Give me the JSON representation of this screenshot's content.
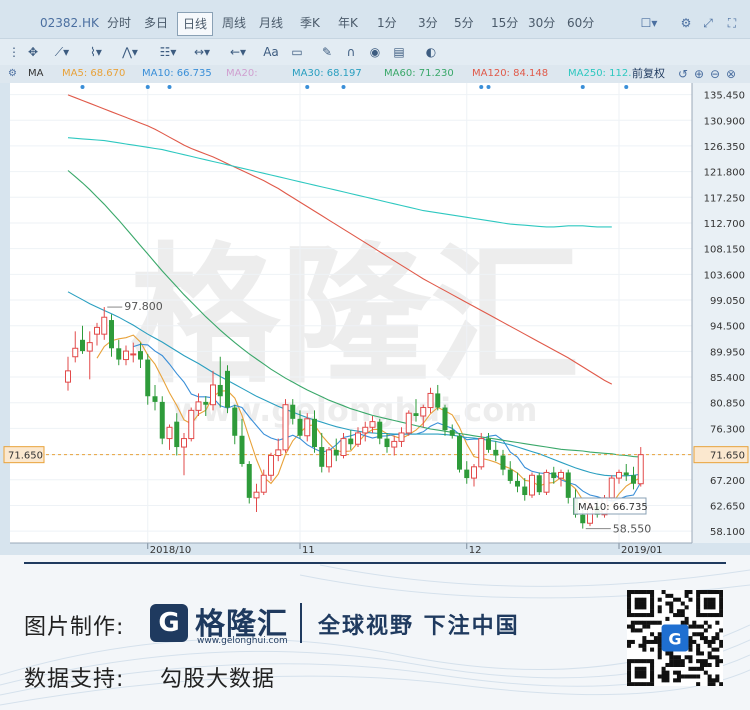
{
  "toolbar": {
    "ticker": "02382.HK",
    "periods": [
      "分时",
      "多日",
      "日线",
      "周线",
      "月线",
      "季K",
      "年K",
      "1分",
      "3分",
      "5分",
      "15分",
      "30分",
      "60分"
    ],
    "active_period": "日线"
  },
  "ma_row": {
    "label": "MA",
    "items": [
      {
        "text": "MA5: 68.670",
        "color": "#e8a23a"
      },
      {
        "text": "MA10: 66.735",
        "color": "#3a8fd8"
      },
      {
        "text": "MA20:",
        "color": "#d0a0d0"
      },
      {
        "text": "MA30: 68.197",
        "color": "#2a9fc0"
      },
      {
        "text": "MA60: 71.230",
        "color": "#3aa86a"
      },
      {
        "text": "MA120: 84.148",
        "color": "#e05a4a"
      },
      {
        "text": "MA250: 112.",
        "color": "#2ec8c0"
      }
    ],
    "adjust_label": "前复权"
  },
  "watermark": {
    "brand": "格隆汇",
    "url": "www.gelonghui.com"
  },
  "chart_data": {
    "type": "candlestick",
    "y_ticks": [
      "135.450",
      "130.900",
      "126.350",
      "121.800",
      "117.250",
      "112.700",
      "108.150",
      "103.600",
      "99.050",
      "94.500",
      "89.950",
      "85.400",
      "80.850",
      "76.300",
      "71.650",
      "67.200",
      "62.650",
      "58.100"
    ],
    "ylim": [
      56.0,
      137.5
    ],
    "x_labels": [
      {
        "label": "2018/10",
        "index": 11
      },
      {
        "label": "11",
        "index": 32
      },
      {
        "label": "12",
        "index": 55
      },
      {
        "label": "2019/01",
        "index": 76
      }
    ],
    "last_price": "71.650",
    "annotations": {
      "high": "97.800",
      "low": "58.550",
      "ma10_box": "MA10: 66.735"
    },
    "ohlc": [
      [
        84.5,
        89.0,
        83.0,
        86.5
      ],
      [
        89.0,
        93.5,
        88.0,
        90.5
      ],
      [
        92.0,
        94.5,
        89.5,
        90.0
      ],
      [
        90.0,
        93.5,
        85.0,
        91.5
      ],
      [
        93.0,
        95.0,
        91.0,
        94.2
      ],
      [
        93.0,
        97.8,
        92.0,
        96.0
      ],
      [
        95.5,
        96.5,
        89.0,
        90.5
      ],
      [
        90.5,
        92.0,
        87.5,
        88.5
      ],
      [
        88.5,
        91.0,
        87.5,
        90.0
      ],
      [
        89.5,
        91.5,
        88.0,
        89.5
      ],
      [
        90.0,
        91.5,
        87.0,
        88.5
      ],
      [
        88.5,
        89.5,
        80.5,
        82.0
      ],
      [
        82.0,
        84.0,
        79.5,
        81.0
      ],
      [
        81.0,
        82.0,
        73.5,
        74.5
      ],
      [
        74.5,
        77.0,
        72.5,
        76.5
      ],
      [
        77.5,
        79.0,
        71.5,
        73.0
      ],
      [
        73.0,
        75.5,
        68.0,
        74.5
      ],
      [
        74.5,
        80.0,
        74.0,
        79.5
      ],
      [
        79.5,
        82.5,
        78.5,
        81.0
      ],
      [
        81.0,
        82.0,
        78.5,
        80.5
      ],
      [
        80.5,
        86.5,
        79.5,
        84.0
      ],
      [
        84.0,
        89.0,
        80.0,
        82.0
      ],
      [
        86.5,
        87.5,
        79.0,
        80.0
      ],
      [
        80.0,
        80.5,
        73.5,
        75.0
      ],
      [
        75.0,
        78.0,
        69.5,
        70.0
      ],
      [
        70.0,
        70.5,
        63.0,
        64.0
      ],
      [
        64.0,
        66.5,
        61.5,
        65.0
      ],
      [
        65.0,
        69.0,
        64.5,
        68.0
      ],
      [
        68.0,
        72.0,
        67.0,
        71.5
      ],
      [
        71.5,
        74.5,
        70.5,
        72.5
      ],
      [
        72.5,
        81.5,
        72.0,
        80.5
      ],
      [
        80.5,
        81.5,
        77.0,
        78.0
      ],
      [
        78.0,
        79.5,
        74.5,
        75.0
      ],
      [
        75.0,
        79.0,
        74.0,
        78.0
      ],
      [
        78.0,
        79.5,
        72.0,
        73.0
      ],
      [
        73.0,
        75.5,
        68.5,
        69.5
      ],
      [
        69.5,
        73.0,
        68.5,
        72.5
      ],
      [
        72.5,
        74.5,
        70.5,
        71.5
      ],
      [
        71.5,
        75.5,
        71.0,
        74.5
      ],
      [
        74.5,
        76.0,
        72.5,
        73.5
      ],
      [
        73.5,
        76.5,
        73.0,
        75.5
      ],
      [
        75.5,
        77.5,
        74.0,
        76.5
      ],
      [
        76.5,
        78.5,
        75.5,
        77.5
      ],
      [
        77.5,
        78.0,
        73.5,
        74.5
      ],
      [
        74.5,
        75.5,
        72.0,
        73.0
      ],
      [
        73.0,
        75.0,
        71.5,
        74.0
      ],
      [
        74.0,
        76.5,
        73.0,
        75.5
      ],
      [
        75.5,
        79.5,
        75.0,
        79.0
      ],
      [
        79.0,
        81.5,
        77.5,
        78.5
      ],
      [
        78.5,
        80.5,
        76.5,
        80.0
      ],
      [
        80.0,
        83.5,
        79.0,
        82.5
      ],
      [
        82.5,
        84.0,
        79.5,
        80.0
      ],
      [
        80.0,
        80.5,
        75.0,
        76.0
      ],
      [
        76.0,
        77.0,
        74.5,
        75.0
      ],
      [
        75.0,
        75.5,
        68.5,
        69.0
      ],
      [
        69.0,
        70.5,
        66.5,
        67.5
      ],
      [
        67.5,
        70.0,
        66.0,
        69.5
      ],
      [
        69.5,
        75.5,
        69.0,
        74.5
      ],
      [
        74.5,
        75.5,
        72.0,
        72.5
      ],
      [
        72.5,
        74.0,
        70.5,
        71.5
      ],
      [
        71.5,
        72.5,
        68.0,
        69.0
      ],
      [
        69.0,
        70.5,
        66.5,
        67.0
      ],
      [
        67.0,
        68.5,
        65.0,
        66.0
      ],
      [
        66.0,
        67.5,
        63.5,
        64.5
      ],
      [
        64.5,
        68.5,
        64.0,
        68.0
      ],
      [
        68.0,
        68.5,
        64.5,
        65.0
      ],
      [
        65.0,
        69.0,
        64.5,
        68.5
      ],
      [
        68.5,
        69.5,
        66.5,
        67.5
      ],
      [
        67.5,
        69.0,
        66.0,
        68.5
      ],
      [
        68.5,
        69.0,
        63.0,
        64.0
      ],
      [
        64.0,
        65.5,
        60.5,
        61.0
      ],
      [
        61.0,
        62.0,
        58.55,
        59.5
      ],
      [
        59.5,
        63.0,
        59.0,
        62.5
      ],
      [
        62.5,
        63.5,
        60.5,
        61.0
      ],
      [
        61.0,
        64.5,
        60.5,
        64.0
      ],
      [
        64.0,
        68.0,
        63.5,
        67.5
      ],
      [
        67.5,
        69.0,
        66.5,
        68.5
      ],
      [
        68.5,
        70.0,
        67.0,
        68.0
      ],
      [
        68.0,
        69.5,
        65.5,
        66.5
      ],
      [
        66.5,
        73.0,
        66.0,
        71.65
      ]
    ],
    "ma_lines": [
      {
        "name": "MA5",
        "color": "#e8a23a",
        "values": [
          null,
          null,
          null,
          null,
          88.74,
          90.82,
          91.84,
          92.18,
          92.38,
          92.84,
          91.6,
          89.28,
          87.68,
          85.2,
          82.6,
          80.36,
          77.82,
          77.1,
          78.8,
          79.52,
          81.92,
          82.9,
          82.98,
          81.68,
          78.6,
          74.6,
          70.8,
          67.64,
          66.56,
          68.2,
          71.7,
          74.1,
          75.5,
          76.8,
          76.9,
          75.04,
          73.6,
          72.3,
          72.2,
          72.3,
          73.8,
          75.3,
          76.1,
          76.14,
          75.36,
          74.9,
          74.5,
          75.2,
          76.0,
          77.2,
          78.9,
          80.0,
          79.4,
          78.7,
          76.5,
          73.5,
          71.3,
          71.0,
          70.7,
          70.3,
          69.7,
          69.2,
          68.4,
          67.1,
          66.9,
          66.1,
          66.6,
          66.7,
          67.6,
          66.7,
          65.6,
          63.6,
          62.9,
          61.6,
          61.6,
          62.9,
          64.7,
          66.1,
          66.9,
          67.6
        ]
      },
      {
        "name": "MA10",
        "color": "#3a8fd8",
        "values": [
          null,
          null,
          null,
          null,
          null,
          null,
          null,
          null,
          null,
          90.8,
          91.2,
          91.1,
          90.0,
          89.2,
          87.7,
          86.0,
          84.5,
          82.4,
          81.9,
          81.9,
          81.7,
          80.3,
          79.9,
          80.4,
          80.0,
          78.3,
          76.8,
          75.3,
          74.6,
          74.2,
          74.6,
          75.1,
          74.5,
          73.4,
          72.7,
          72.1,
          72.4,
          73.4,
          74.7,
          75.0,
          75.4,
          75.0,
          74.6,
          74.9,
          75.0,
          75.2,
          75.3,
          75.3,
          75.3,
          75.7,
          76.7,
          77.3,
          76.8,
          76.3,
          75.2,
          74.3,
          74.4,
          74.4,
          74.9,
          75.1,
          74.2,
          72.1,
          71.2,
          69.4,
          68.7,
          68.4,
          68.3,
          68.3,
          67.2,
          66.7,
          66.3,
          65.2,
          64.5,
          64.2,
          63.8,
          63.4,
          63.8,
          64.3,
          64.5,
          66.735
        ]
      },
      {
        "name": "MA30",
        "color": "#2a9fc0",
        "values": [
          100.5,
          99.8,
          99.1,
          98.4,
          97.8,
          97.2,
          96.6,
          96.0,
          95.3,
          94.6,
          93.8,
          93.0,
          92.3,
          91.6,
          90.8,
          90.0,
          89.2,
          88.5,
          87.8,
          87.0,
          86.2,
          85.5,
          84.8,
          84.1,
          83.4,
          82.7,
          82.0,
          81.4,
          80.8,
          80.2,
          79.7,
          79.2,
          78.7,
          78.2,
          77.8,
          77.4,
          77.0,
          76.6,
          76.3,
          76.0,
          75.8,
          75.6,
          75.5,
          75.4,
          75.4,
          75.3,
          75.3,
          75.3,
          75.3,
          75.3,
          75.3,
          75.3,
          75.2,
          75.1,
          74.9,
          74.7,
          74.6,
          74.4,
          74.2,
          74.0,
          73.7,
          73.4,
          73.0,
          72.6,
          72.2,
          71.8,
          71.3,
          70.8,
          70.3,
          69.8,
          69.3,
          68.9,
          68.5,
          68.2,
          68.0,
          67.9,
          67.9,
          67.9,
          68.0,
          68.197
        ]
      },
      {
        "name": "MA60",
        "color": "#3aa86a",
        "values": [
          122.0,
          120.9,
          119.8,
          118.6,
          117.3,
          116.0,
          114.6,
          113.2,
          111.7,
          110.2,
          108.7,
          107.2,
          105.7,
          104.2,
          102.8,
          101.4,
          100.0,
          98.7,
          97.4,
          96.1,
          94.9,
          93.7,
          92.6,
          91.5,
          90.5,
          89.5,
          88.6,
          87.7,
          86.8,
          86.0,
          85.2,
          84.5,
          83.8,
          83.1,
          82.5,
          81.9,
          81.3,
          80.8,
          80.3,
          79.8,
          79.4,
          79.0,
          78.6,
          78.3,
          78.0,
          77.7,
          77.4,
          77.1,
          76.8,
          76.5,
          76.2,
          76.0,
          75.8,
          75.6,
          75.4,
          75.2,
          75.0,
          74.8,
          74.6,
          74.4,
          74.2,
          74.0,
          73.8,
          73.6,
          73.4,
          73.2,
          73.0,
          72.8,
          72.6,
          72.5,
          72.4,
          72.3,
          72.1,
          72.0,
          71.9,
          71.8,
          71.6,
          71.5,
          71.3,
          71.23
        ]
      },
      {
        "name": "MA120",
        "color": "#e05a4a",
        "values": [
          135.4,
          134.9,
          134.4,
          133.9,
          133.4,
          132.9,
          132.4,
          131.9,
          131.4,
          130.9,
          130.4,
          129.9,
          129.3,
          128.6,
          127.9,
          127.2,
          126.5,
          125.9,
          125.4,
          124.9,
          124.4,
          123.8,
          123.2,
          122.6,
          122.0,
          121.4,
          120.8,
          120.2,
          119.5,
          118.8,
          118.0,
          117.2,
          116.4,
          115.6,
          114.8,
          114.0,
          113.2,
          112.4,
          111.6,
          110.8,
          110.0,
          109.2,
          108.4,
          107.6,
          106.8,
          106.0,
          105.2,
          104.4,
          103.6,
          102.8,
          102.1,
          101.4,
          100.7,
          100.0,
          99.3,
          98.6,
          97.9,
          97.2,
          96.5,
          95.8,
          95.1,
          94.4,
          93.7,
          93.0,
          92.3,
          91.6,
          90.9,
          90.2,
          89.5,
          88.8,
          88.0,
          87.2,
          86.4,
          85.6,
          84.8,
          84.148
        ]
      },
      {
        "name": "MA250",
        "color": "#2ec8c0",
        "values": [
          127.8,
          127.7,
          127.6,
          127.5,
          127.4,
          127.3,
          127.1,
          126.9,
          126.7,
          126.5,
          126.3,
          126.1,
          125.9,
          125.7,
          125.4,
          125.1,
          124.8,
          124.5,
          124.2,
          123.9,
          123.6,
          123.3,
          123.0,
          122.7,
          122.4,
          122.1,
          121.8,
          121.5,
          121.2,
          120.9,
          120.6,
          120.3,
          120.0,
          119.7,
          119.4,
          119.1,
          118.8,
          118.5,
          118.2,
          117.9,
          117.6,
          117.3,
          117.0,
          116.7,
          116.4,
          116.1,
          115.8,
          115.5,
          115.2,
          114.9,
          114.7,
          114.5,
          114.3,
          114.1,
          113.9,
          113.7,
          113.5,
          113.3,
          113.1,
          112.9,
          112.7,
          112.5,
          112.4,
          112.3,
          112.2,
          112.1,
          112.0,
          112.0,
          112.1,
          112.2,
          112.2,
          112.2,
          112.1,
          112.0,
          112.0,
          112.0
        ]
      }
    ],
    "up_color": "#e24a4a",
    "down_color": "#2e9b3a"
  },
  "footer": {
    "made_by_label": "图片制作:",
    "brand_name": "格隆汇",
    "brand_url": "www.gelonghui.com",
    "slogan": "全球视野 下注中国",
    "data_label": "数据支持:",
    "data_source": "勾股大数据"
  }
}
